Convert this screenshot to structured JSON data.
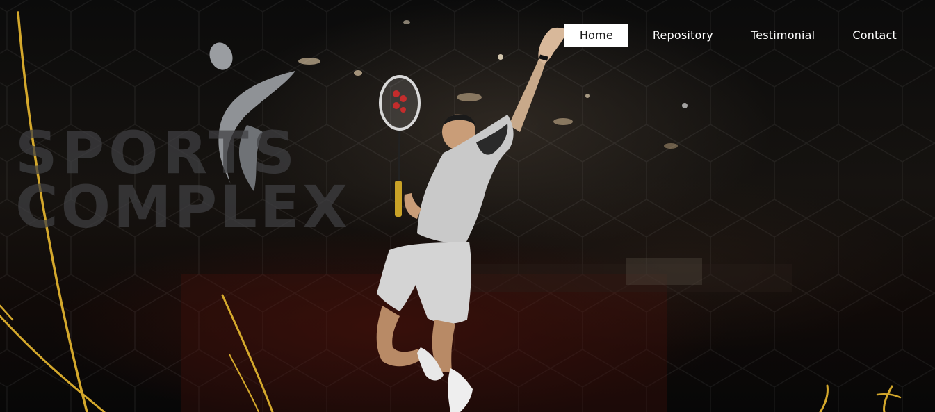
{
  "nav": {
    "items": [
      {
        "label": "Home",
        "active": true
      },
      {
        "label": "Repository",
        "active": false
      },
      {
        "label": "Testimonial",
        "active": false
      },
      {
        "label": "Contact",
        "active": false
      }
    ]
  },
  "logo": {
    "line1": "SPORTS",
    "line2": "COMPLEX"
  },
  "colors": {
    "accent_gold": "#d4a82c",
    "logo_gray": "#8f9296",
    "background": "#050505"
  }
}
